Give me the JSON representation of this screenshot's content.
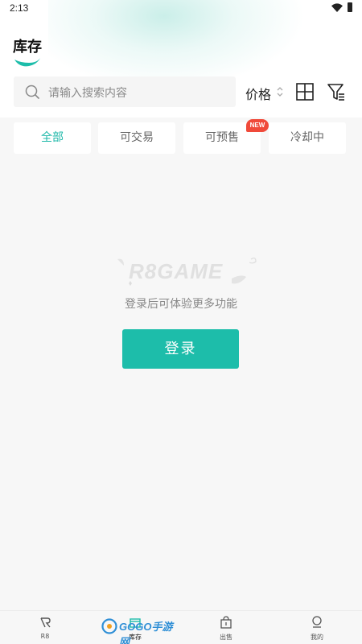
{
  "status_bar": {
    "time": "2:13"
  },
  "header": {
    "title": "库存"
  },
  "search": {
    "placeholder": "请输入搜索内容"
  },
  "toolbar": {
    "price_label": "价格"
  },
  "tabs": [
    {
      "label": "全部",
      "active": true
    },
    {
      "label": "可交易",
      "active": false
    },
    {
      "label": "可预售",
      "active": false,
      "badge": "NEW"
    },
    {
      "label": "冷却中",
      "active": false
    }
  ],
  "empty_state": {
    "logo_text": "R8GAME",
    "message": "登录后可体验更多功能",
    "login_label": "登录"
  },
  "bottom_nav": [
    {
      "label": "R8",
      "icon": "r8-logo-icon",
      "active": false
    },
    {
      "label": "库存",
      "icon": "inventory-icon",
      "active": true
    },
    {
      "label": "出售",
      "icon": "sell-bag-icon",
      "active": false
    },
    {
      "label": "我的",
      "icon": "profile-icon",
      "active": false
    }
  ],
  "watermark": {
    "text": "GOGO手游网"
  },
  "colors": {
    "accent": "#1dbdaa",
    "badge": "#f04a3a"
  }
}
